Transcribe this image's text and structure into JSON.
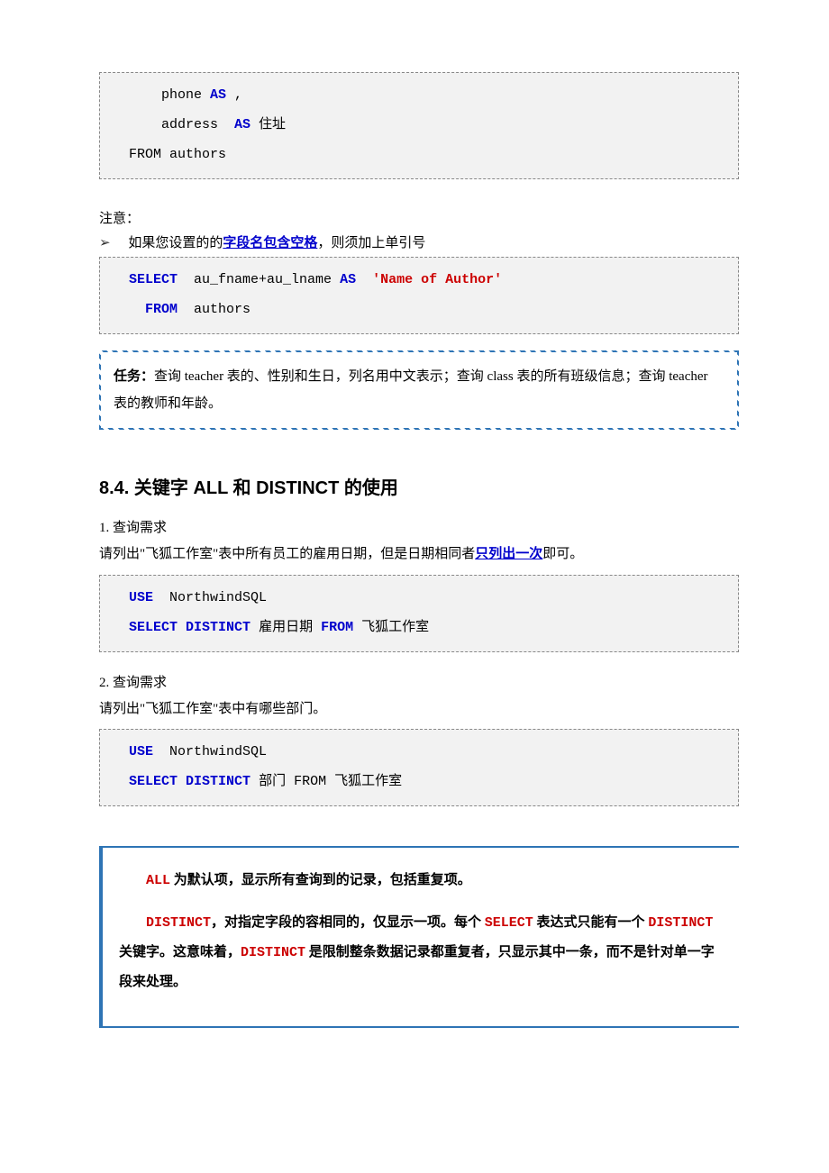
{
  "code1": {
    "l1a": "      phone ",
    "l1k": "AS",
    "l1b": " ,",
    "l2a": "      address  ",
    "l2k": "AS",
    "l2b": " 住址",
    "l3": "  FROM authors"
  },
  "note": {
    "label": "注意：",
    "arrow": "➢",
    "bullet_pre": "如果您设置的的",
    "bullet_hl": "字段名包含空格",
    "bullet_post": "，则须加上单引号"
  },
  "code2": {
    "indent": "  ",
    "kw1": "SELECT",
    "mid": "  au_fname+au_lname ",
    "kw2": "AS",
    "sp": "  ",
    "str": "'Name of Author'",
    "l2indent": "    ",
    "kw3": "FROM",
    "tail": "  authors"
  },
  "task": {
    "label": "任务：",
    "text": "查询 teacher 表的、性别和生日，列名用中文表示；查询 class 表的所有班级信息；查询 teacher 表的教师和年龄。"
  },
  "section_title": "8.4. 关键字 ALL 和 DISTINCT 的使用",
  "req1": {
    "num": "1.   查询需求",
    "desc_pre": "请列出\"飞狐工作室\"表中所有员工的雇用日期，但是日期相同者",
    "desc_hl": "只列出一次",
    "desc_post": "即可。"
  },
  "code3": {
    "l1kw": "USE",
    "l1t": "  NorthwindSQL",
    "l2kw1": "SELECT",
    "l2kw2": "DISTINCT",
    "l2m": " 雇用日期 ",
    "l2kw3": "FROM",
    "l2t": " 飞狐工作室"
  },
  "req2": {
    "num": "2.   查询需求",
    "desc": "请列出\"飞狐工作室\"表中有哪些部门。"
  },
  "code4": {
    "l1kw": "USE",
    "l1t": "  NorthwindSQL",
    "l2kw1": "SELECT",
    "l2kw2": "DISTINCT",
    "l2m": " 部门 ",
    "l2from": "FROM",
    "l2t": " 飞狐工作室"
  },
  "emph": {
    "p1_kw": "ALL",
    "p1_text": " 为默认项，显示所有查询到的记录，包括重复项。",
    "p2_kw1": "DISTINCT",
    "p2_m1": "，对指定字段的容相同的，仅显示一项。每个 ",
    "p2_kw2": "SELECT",
    "p2_m2": " 表达式只能有一个 ",
    "p2_kw3": "DISTINCT",
    "p2_m3": " 关键字。这意味着，",
    "p2_kw4": "DISTINCT",
    "p2_m4": " 是限制整条数据记录都重复者，只显示其中一条，而不是针对单一字段来处理。"
  }
}
